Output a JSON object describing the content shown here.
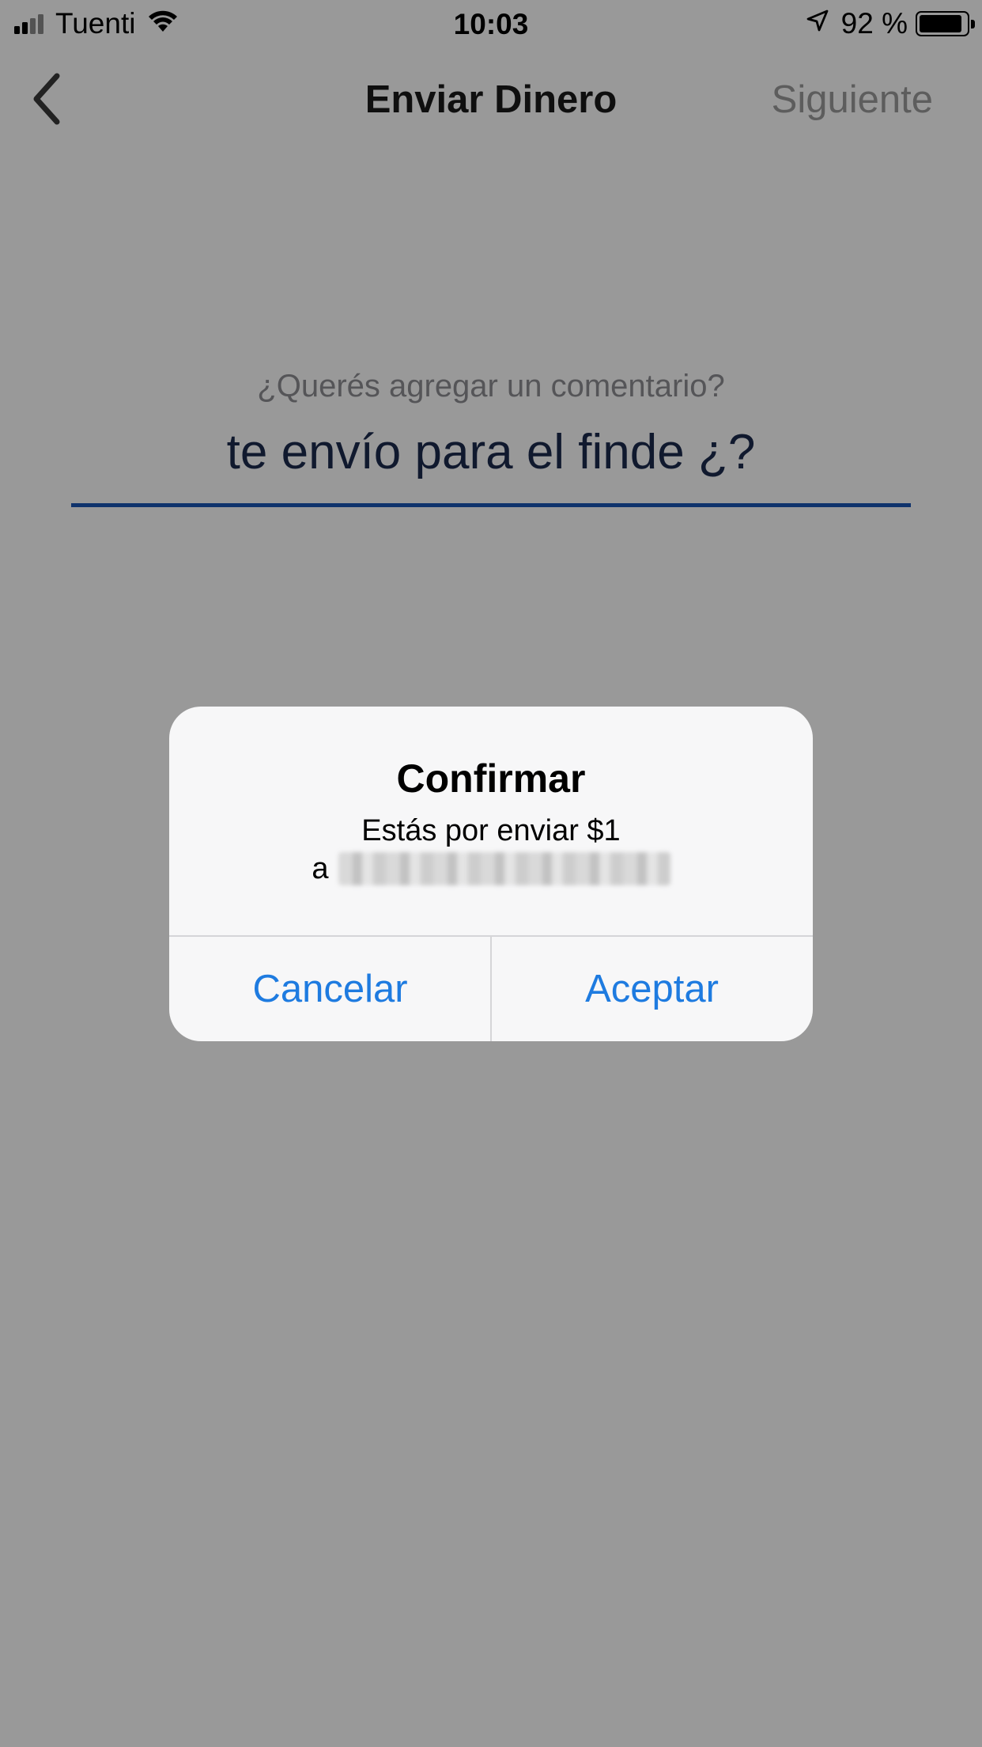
{
  "status_bar": {
    "carrier": "Tuenti",
    "time": "10:03",
    "battery_percent": "92 %",
    "battery_level": 0.92,
    "signal_bars_active": 2,
    "icons": [
      "signal-icon",
      "wifi-icon",
      "location-arrow-icon",
      "battery-icon"
    ]
  },
  "nav": {
    "title": "Enviar Dinero",
    "next_label": "Siguiente",
    "back_icon": "chevron-left-icon"
  },
  "comment": {
    "label": "¿Querés agregar un comentario?",
    "value": "te envío para el finde ¿?"
  },
  "alert": {
    "title": "Confirmar",
    "message_line1": "Estás por enviar $1",
    "recipient_prefix": "a",
    "cancel_label": "Cancelar",
    "accept_label": "Aceptar"
  },
  "colors": {
    "accent_blue": "#1e7be0",
    "underline_blue": "#1a55b4",
    "input_text": "#1b2a4e",
    "overlay": "#999999"
  }
}
